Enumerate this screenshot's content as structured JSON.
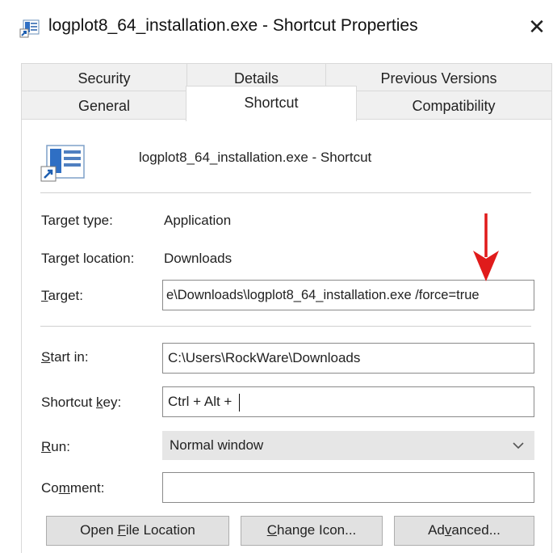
{
  "window": {
    "title": "logplot8_64_installation.exe - Shortcut Properties",
    "close_glyph": "✕"
  },
  "tabs": {
    "row1": [
      "Security",
      "Details",
      "Previous Versions"
    ],
    "row2": [
      "General",
      "Shortcut",
      "Compatibility"
    ],
    "active": "Shortcut"
  },
  "shortcut": {
    "name": "logplot8_64_installation.exe - Shortcut",
    "icon": "shortcut-app-icon"
  },
  "fields": {
    "target_type_label": "Target type:",
    "target_type_value": "Application",
    "target_location_label": "Target location:",
    "target_location_value": "Downloads",
    "target_label_u": "T",
    "target_label_rest": "arget:",
    "target_value": "e\\Downloads\\logplot8_64_installation.exe /force=true",
    "start_in_label_u": "S",
    "start_in_label_rest": "tart in:",
    "start_in_value": "C:\\Users\\RockWare\\Downloads",
    "shortcut_key_label_pre": "Shortcut ",
    "shortcut_key_label_u": "k",
    "shortcut_key_label_rest": "ey:",
    "shortcut_key_value": "Ctrl + Alt + ",
    "run_label_u": "R",
    "run_label_rest": "un:",
    "run_value": "Normal window",
    "comment_label_pre": "Co",
    "comment_label_u": "m",
    "comment_label_rest": "ment:",
    "comment_value": ""
  },
  "buttons": {
    "open_file_pre": "Open ",
    "open_file_u": "F",
    "open_file_rest": "ile Location",
    "change_icon_u": "C",
    "change_icon_rest": "hange Icon...",
    "advanced_pre": "Ad",
    "advanced_u": "v",
    "advanced_rest": "anced..."
  },
  "annotation": {
    "arrow_color": "#e01b1b"
  },
  "colors": {
    "tab_bg": "#f0f0f0",
    "field_border": "#8a8a8a",
    "button_bg": "#e1e1e1"
  }
}
